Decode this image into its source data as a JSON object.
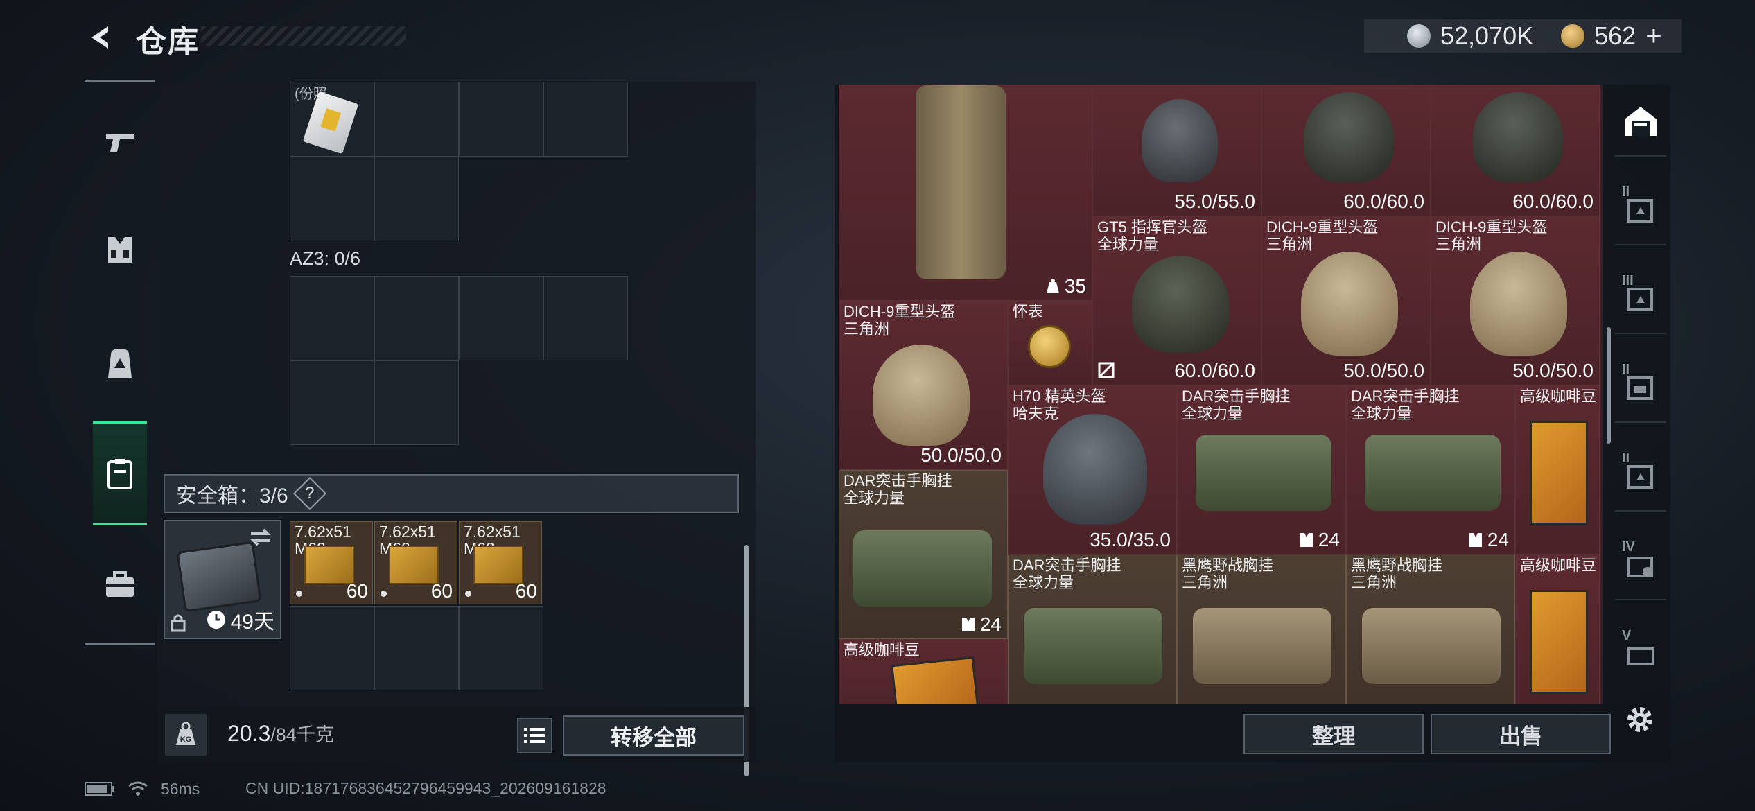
{
  "header": {
    "title": "仓库",
    "currency": [
      {
        "icon": "silver-coin-icon",
        "value": "52,070K"
      },
      {
        "icon": "gold-coin-icon",
        "value": "562",
        "add": "+"
      }
    ]
  },
  "left_nav": {
    "items": [
      {
        "icon": "pistol-icon"
      },
      {
        "icon": "chest-rig-icon"
      },
      {
        "icon": "backpack-icon"
      },
      {
        "icon": "safebox-nav-icon",
        "active": true
      },
      {
        "icon": "briefcase-icon"
      }
    ]
  },
  "left_panel": {
    "top_item_label": "(份照...",
    "az3_label": "AZ3: 0/6",
    "safebox_label": "安全箱：3/6",
    "help": "?",
    "case_timer": "49天",
    "ammo": [
      {
        "line1": "7.62x51",
        "line2": "M62",
        "qty": "60"
      },
      {
        "line1": "7.62x51",
        "line2": "M62",
        "qty": "60"
      },
      {
        "line1": "7.62x51",
        "line2": "M62",
        "qty": "60"
      }
    ],
    "weight_current": "20.3",
    "weight_max": "/84千克",
    "transfer_all": "转移全部",
    "kg_icon_text": "KG"
  },
  "stash": {
    "items": [
      {
        "id": "vest-tall",
        "name": "",
        "count": "35"
      },
      {
        "id": "helm1",
        "name": "",
        "sub": "",
        "value": "55.0/55.0"
      },
      {
        "id": "helm2",
        "name": "",
        "sub": "",
        "value": "60.0/60.0"
      },
      {
        "id": "helm3",
        "name": "",
        "sub": "",
        "value": "60.0/60.0"
      },
      {
        "id": "gt5",
        "name": "GT5 指挥官头盔",
        "sub": "全球力量",
        "value": "60.0/60.0"
      },
      {
        "id": "dich1",
        "name": "DICH-9重型头盔",
        "sub": "三角洲",
        "value": "50.0/50.0"
      },
      {
        "id": "dich2",
        "name": "DICH-9重型头盔",
        "sub": "三角洲",
        "value": "50.0/50.0"
      },
      {
        "id": "dich3",
        "name": "DICH-9重型头盔",
        "sub": "三角洲",
        "value": "50.0/50.0"
      },
      {
        "id": "watch",
        "name": "怀表",
        "sub": ""
      },
      {
        "id": "h70",
        "name": "H70 精英头盔",
        "sub": "哈夫克",
        "value": "35.0/35.0"
      },
      {
        "id": "dar1",
        "name": "DAR突击手胸挂",
        "sub": "全球力量",
        "count": "24"
      },
      {
        "id": "dar2",
        "name": "DAR突击手胸挂",
        "sub": "全球力量",
        "count": "24"
      },
      {
        "id": "coffee1",
        "name": "高级咖啡豆",
        "sub": ""
      },
      {
        "id": "dar3",
        "name": "DAR突击手胸挂",
        "sub": "全球力量",
        "count": "24"
      },
      {
        "id": "dar4",
        "name": "DAR突击手胸挂",
        "sub": "全球力量"
      },
      {
        "id": "hy1",
        "name": "黑鹰野战胸挂",
        "sub": "三角洲"
      },
      {
        "id": "hy2",
        "name": "黑鹰野战胸挂",
        "sub": "三角洲"
      },
      {
        "id": "coffee2",
        "name": "高级咖啡豆",
        "sub": ""
      },
      {
        "id": "coffee3",
        "name": "高级咖啡豆",
        "sub": ""
      }
    ],
    "sort": "整理",
    "sell": "出售"
  },
  "right_tabs": [
    {
      "label": "",
      "icon": "stash-home-icon",
      "active": true
    },
    {
      "label": "II",
      "icon": "expansion-box-icon"
    },
    {
      "label": "III",
      "icon": "expansion-box-icon"
    },
    {
      "label": "II",
      "icon": "expansion-box-icon"
    },
    {
      "label": "II",
      "icon": "expansion-box-icon"
    },
    {
      "label": "IV",
      "icon": "expansion-box-icon"
    },
    {
      "label": "V",
      "icon": "expansion-box-icon"
    }
  ],
  "status": {
    "ping": "56ms",
    "uid": "CN UID:187176836452796459943_202609161828"
  },
  "colors": {
    "accent": "#3be39b",
    "stash_bg": "#4a2228",
    "ammo_bg": "#3f3427"
  }
}
